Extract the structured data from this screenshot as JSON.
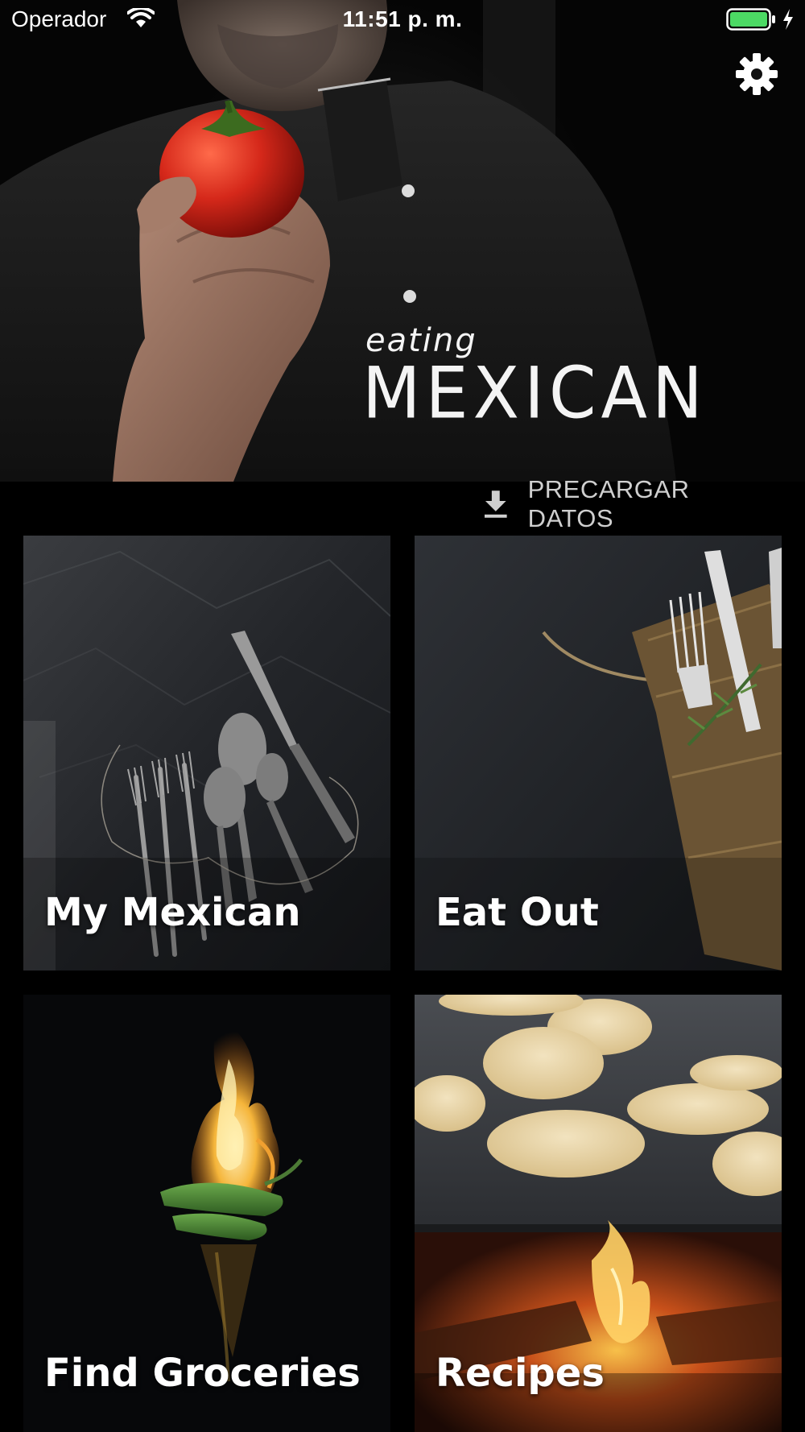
{
  "status_bar": {
    "carrier": "Operador",
    "time": "11:51 p. m.",
    "battery_color": "#4cd964"
  },
  "header": {
    "logo_small": "eating",
    "logo_large": "MEXICAN",
    "settings_icon": "gear-icon"
  },
  "preload": {
    "icon": "download-icon",
    "label": "PRECARGAR DATOS"
  },
  "tiles": [
    {
      "label": "My Mexican",
      "image": "cutlery-on-crumpled-paper"
    },
    {
      "label": "Eat Out",
      "image": "fork-knife-in-burlap"
    },
    {
      "label": "Find Groceries",
      "image": "flaming-green-chilies"
    },
    {
      "label": "Recipes",
      "image": "tortillas-on-griddle-over-fire"
    }
  ]
}
